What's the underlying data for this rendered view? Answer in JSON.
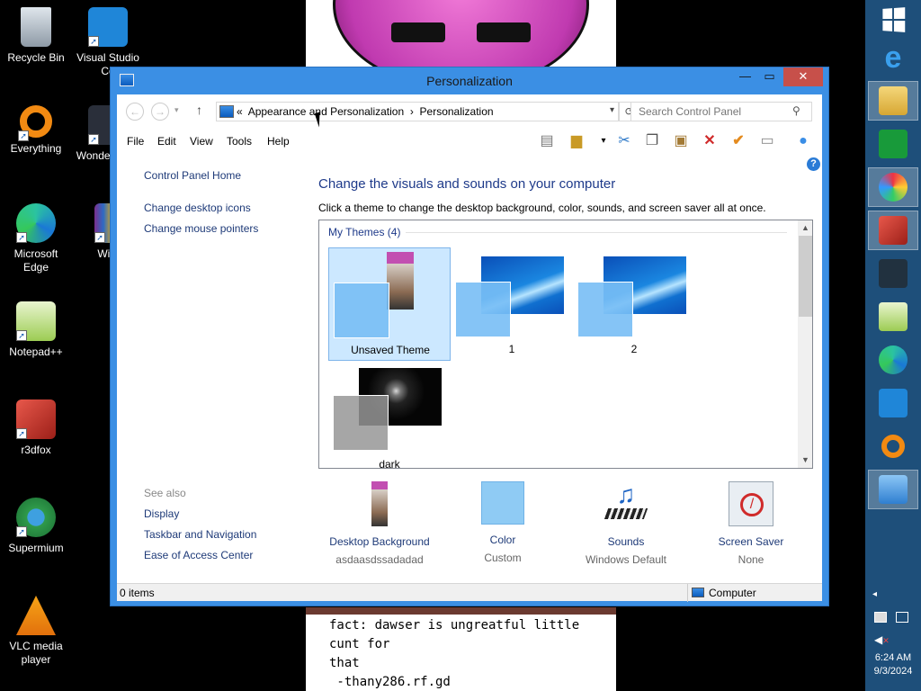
{
  "desktop": {
    "icons": [
      {
        "label": "Recycle Bin",
        "icon": "recycle-bin-icon"
      },
      {
        "label": "Visual Studio Co",
        "icon": "vscode-icon"
      },
      {
        "label": "Everything",
        "icon": "everything-icon"
      },
      {
        "label": "Wonde Filmo",
        "icon": "wondershare-icon"
      },
      {
        "label": "Microsoft Edge",
        "icon": "edge-icon"
      },
      {
        "label": "Winl",
        "icon": "winrar-icon"
      },
      {
        "label": "Notepad++",
        "icon": "notepadpp-icon"
      },
      {
        "label": "r3dfox",
        "icon": "r3dfox-icon"
      },
      {
        "label": "Supermium",
        "icon": "supermium-icon"
      },
      {
        "label": "VLC media player",
        "icon": "vlc-icon"
      }
    ],
    "wallpaper_text": [
      "fact: dawser is ungreatful little cunt for",
      "that",
      " -thany286.rf.gd"
    ]
  },
  "window": {
    "title": "Personalization",
    "address": {
      "prefix": "«",
      "crumb1": "Appearance and Personalization",
      "sep": "›",
      "crumb2": "Personalization"
    },
    "search_placeholder": "Search Control Panel",
    "menu": [
      "File",
      "Edit",
      "View",
      "Tools",
      "Help"
    ],
    "left_links": [
      "Control Panel Home",
      "Change desktop icons",
      "Change mouse pointers"
    ],
    "see_also": {
      "heading": "See also",
      "links": [
        "Display",
        "Taskbar and Navigation",
        "Ease of Access Center"
      ]
    },
    "main": {
      "title": "Change the visuals and sounds on your computer",
      "desc": "Click a theme to change the desktop background, color, sounds, and screen saver all at once.",
      "themes_heading": "My Themes (4)",
      "themes": [
        "Unsaved Theme",
        "1",
        "2",
        "dark"
      ]
    },
    "bottom": [
      {
        "label": "Desktop Background",
        "value": "asdaasdssadadad"
      },
      {
        "label": "Color",
        "value": "Custom"
      },
      {
        "label": "Sounds",
        "value": "Windows Default"
      },
      {
        "label": "Screen Saver",
        "value": "None"
      }
    ],
    "status": {
      "items": "0 items",
      "location": "Computer"
    }
  },
  "taskbar": {
    "time": "6:24 AM",
    "date": "9/3/2024",
    "tray_arrow": "◂"
  },
  "colors": {
    "accent": "#3b8fe4",
    "taskbar": "#1e4f7a",
    "link": "#1e3a78",
    "close": "#c7504a"
  }
}
